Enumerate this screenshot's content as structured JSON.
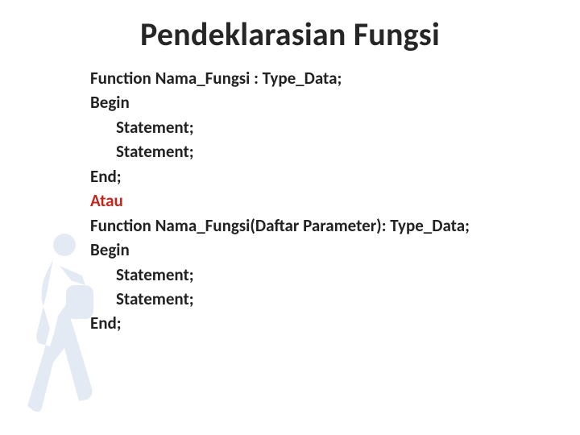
{
  "title": "Pendeklarasian Fungsi",
  "lines": {
    "l1": "Function Nama_Fungsi : Type_Data;",
    "l2": "Begin",
    "l3": "Statement;",
    "l4": "Statement;",
    "l5": "End;",
    "l6": "Atau",
    "l7": "Function Nama_Fungsi(Daftar Parameter): Type_Data;",
    "l8": "Begin",
    "l9": "Statement;",
    "l10": "Statement;",
    "l11": "End;"
  }
}
